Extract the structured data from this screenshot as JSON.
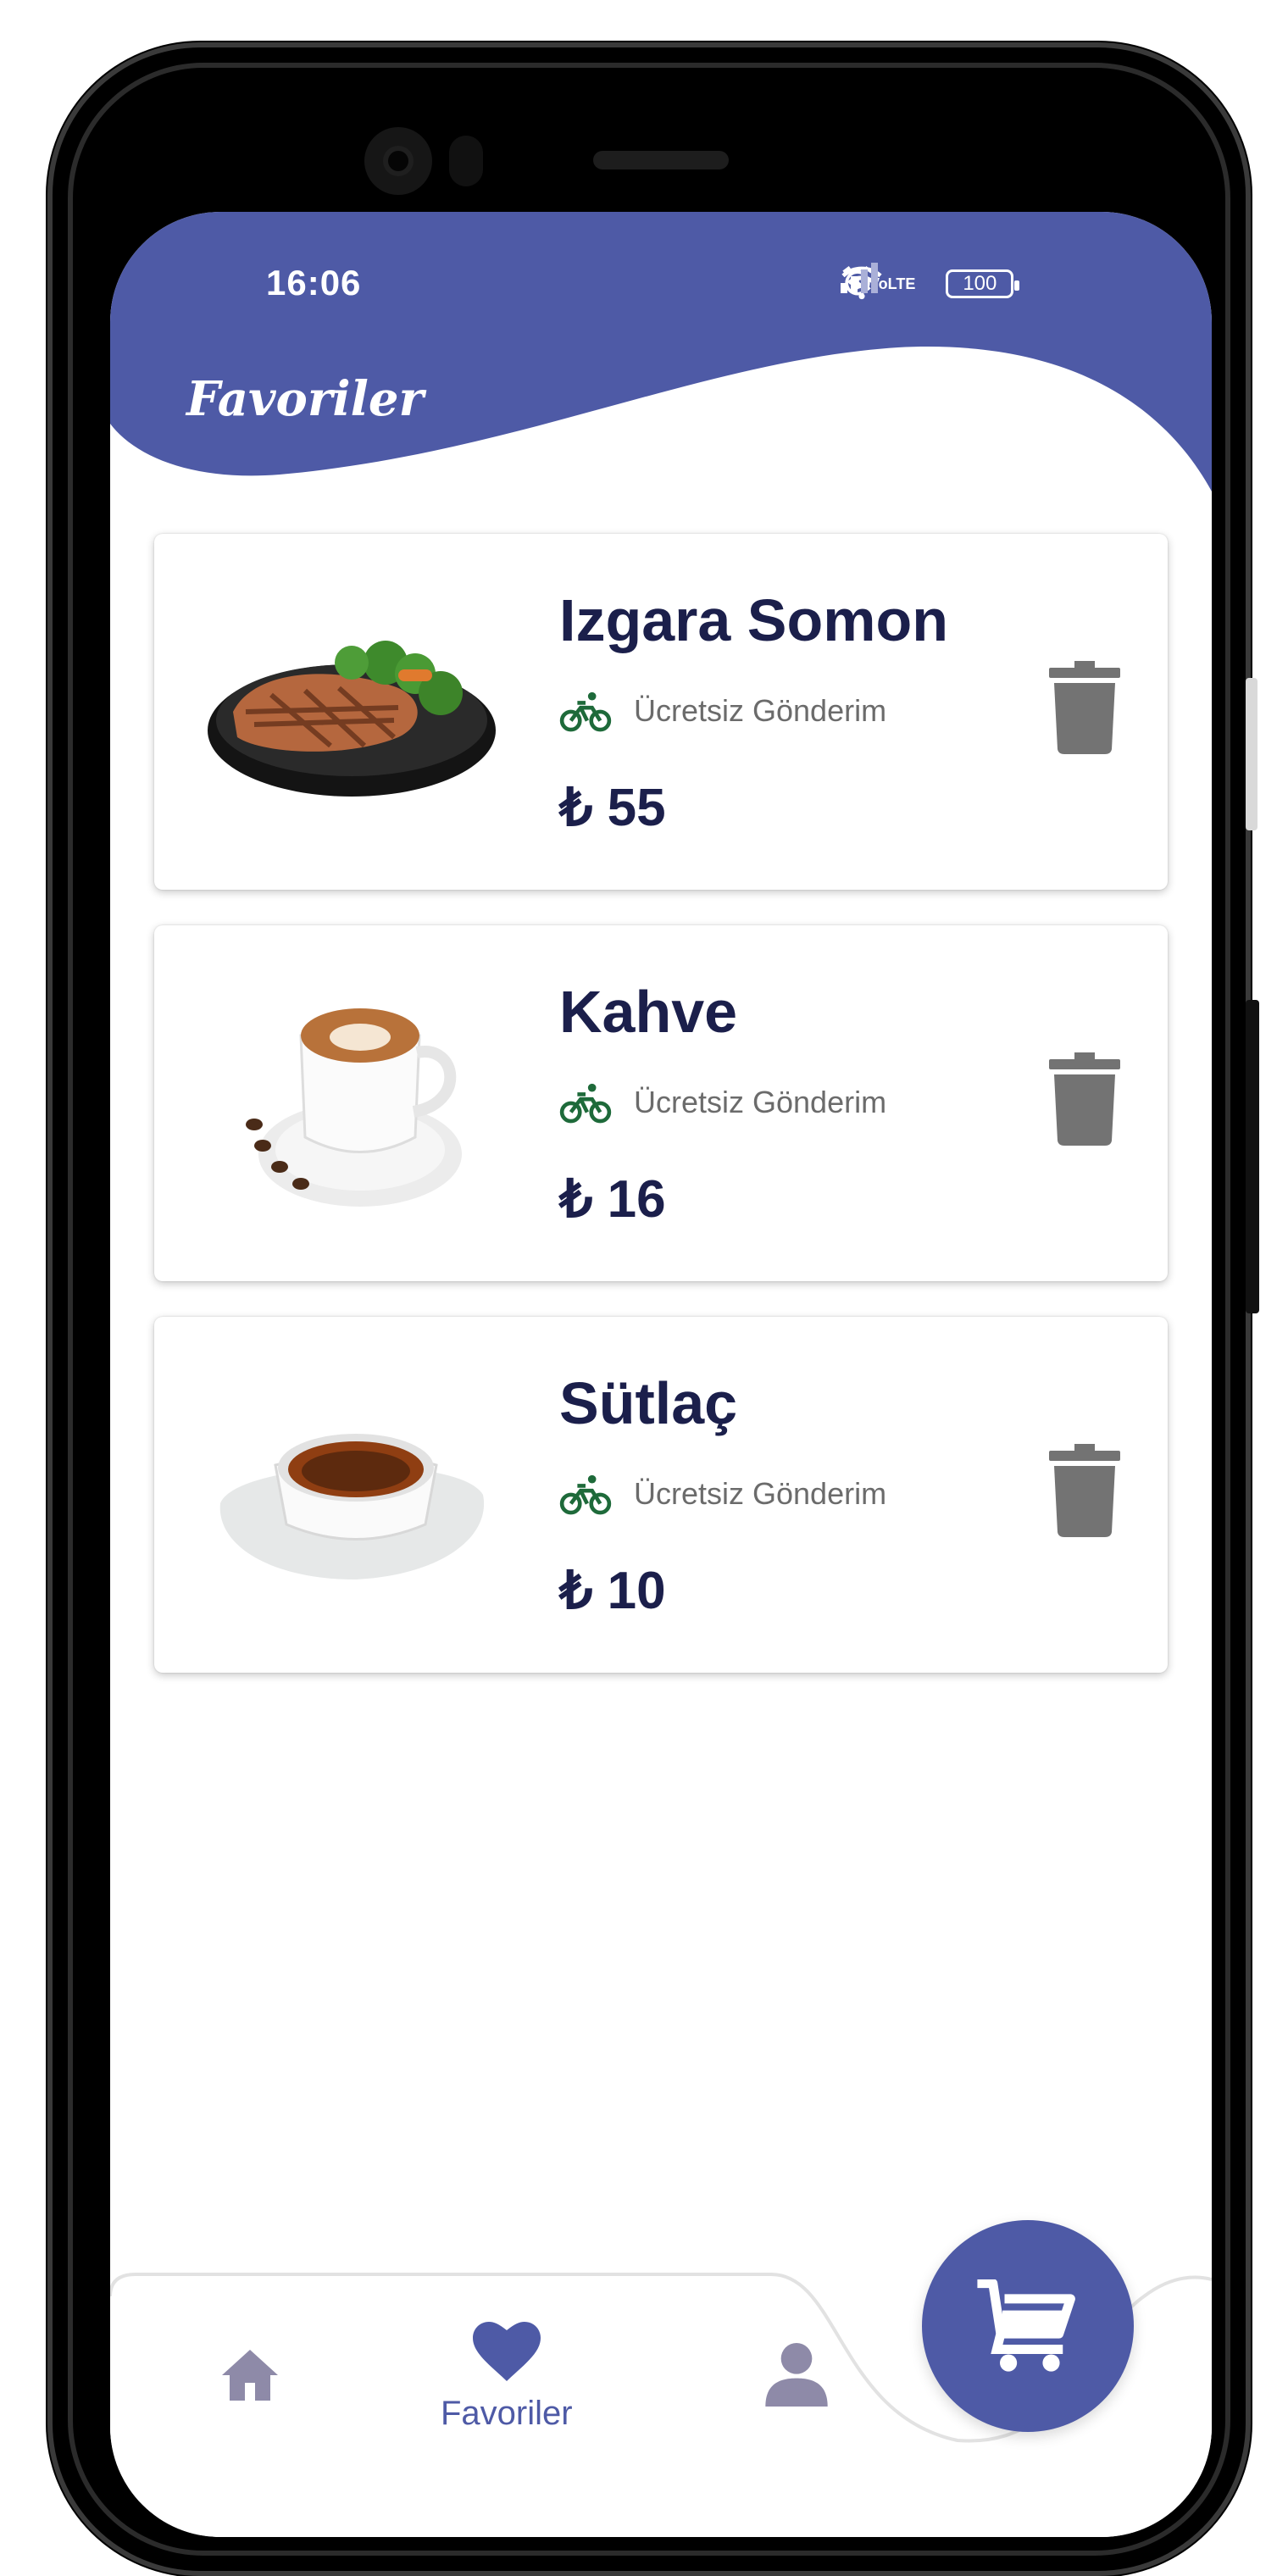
{
  "status_bar": {
    "time": "16:06",
    "volte_top": "Vo",
    "volte_bottom": "LTE",
    "battery": "100"
  },
  "header": {
    "title": "Favoriler"
  },
  "favorites": [
    {
      "name": "Izgara Somon",
      "shipping": "Ücretsiz Gönderim",
      "price": "₺ 55"
    },
    {
      "name": "Kahve",
      "shipping": "Ücretsiz Gönderim",
      "price": "₺ 16"
    },
    {
      "name": "Sütlaç",
      "shipping": "Ücretsiz Gönderim",
      "price": "₺ 10"
    }
  ],
  "bottom_nav": {
    "items": [
      {
        "icon": "home-icon",
        "label": ""
      },
      {
        "icon": "heart-icon",
        "label": "Favoriler",
        "active": true
      },
      {
        "icon": "person-icon",
        "label": ""
      }
    ],
    "fab_icon": "cart-icon"
  },
  "colors": {
    "primary": "#4e5aa6",
    "title_text": "#1b1f4b",
    "muted_text": "#6b6b6b",
    "bike_icon": "#1e6a3a",
    "trash_icon": "#737373",
    "nav_inactive": "#8e8aa8"
  }
}
